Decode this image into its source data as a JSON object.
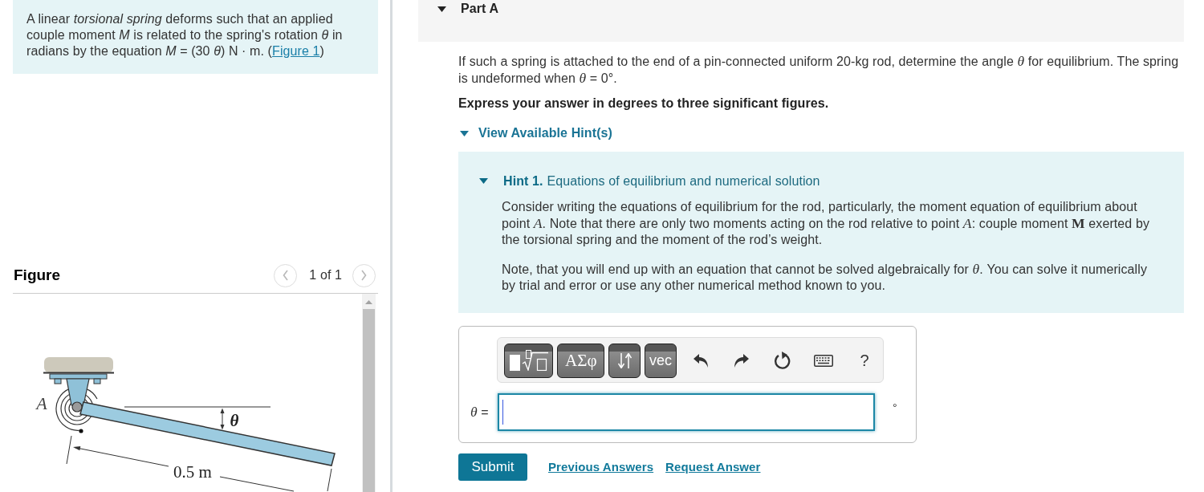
{
  "intro": {
    "text": "A linear *torsional spring* deforms such that an applied couple moment *M* is related to the spring's rotation *θ* in radians by the equation *M* = (30 *θ*) N · m. (",
    "link": "Figure 1",
    "text_after": ")"
  },
  "figure": {
    "title": "Figure",
    "pager": {
      "label": "1 of 1",
      "buttons": [
        {
          "kind": "prev",
          "disabled": true
        },
        {
          "kind": "next",
          "disabled": true
        }
      ]
    },
    "labels": {
      "point": "A",
      "angle": "θ",
      "length": "0.5 m"
    }
  },
  "part": {
    "title": "Part A",
    "expanded": true,
    "question": "If such a spring is attached to the end of a pin-connected uniform 20-kg rod, determine the angle *θ* for equilibrium. The spring is undeformed when *θ* = 0°.",
    "instruction": "Express your answer in degrees to three significant figures.",
    "hints_toggle": {
      "label": "View Available Hint(s)",
      "expanded": true
    },
    "hints": [
      {
        "number": "Hint 1.",
        "title": "Equations of equilibrium and numerical solution",
        "expanded": true,
        "paragraphs": [
          "Consider writing the equations of equilibrium for the rod, particularly, the moment equation of equilibrium about point *A*. Note that there are only two moments acting on the rod relative to point *A*: couple moment **M** exerted by the torsional spring and the moment of the rod’s weight.",
          "Note, that you will end up with an equation that cannot be solved algebraically for *θ*. You can solve it numerically by trial and error or use any other numerical method known to you."
        ]
      }
    ],
    "answer": {
      "toolbar": [
        {
          "kind": "templates"
        },
        {
          "kind": "symbols",
          "label": "ΑΣφ"
        },
        {
          "kind": "arrows"
        },
        {
          "kind": "vector",
          "label": "vec"
        },
        {
          "kind": "undo"
        },
        {
          "kind": "redo"
        },
        {
          "kind": "reset"
        },
        {
          "kind": "keyboard"
        },
        {
          "kind": "help",
          "label": "?"
        }
      ],
      "label": "*θ* =",
      "unit": "°",
      "focused": true
    },
    "actions": {
      "submit": "Submit",
      "links": [
        "Previous Answers",
        "Request Answer"
      ]
    }
  }
}
